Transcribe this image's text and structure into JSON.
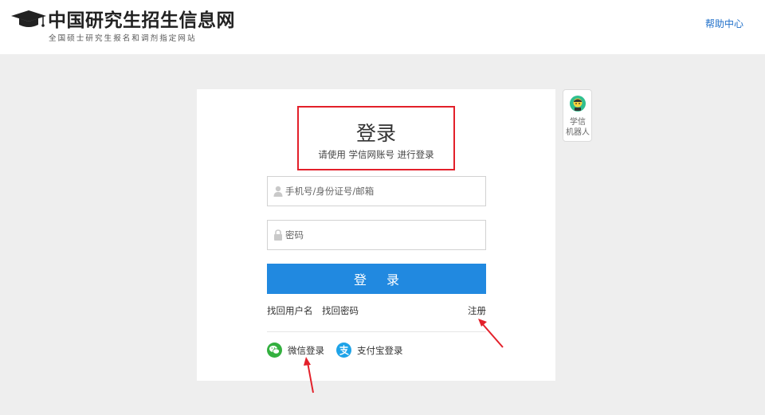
{
  "header": {
    "logo_title": "中国研究生招生信息网",
    "logo_subtitle": "全国硕士研究生报名和调剂指定网站",
    "help_link": "帮助中心"
  },
  "login": {
    "title": "登录",
    "subtitle": "请使用 学信网账号 进行登录",
    "username_placeholder": "手机号/身份证号/邮箱",
    "password_placeholder": "密码",
    "submit_label": "登 录",
    "forgot_username": "找回用户名",
    "forgot_password": "找回密码",
    "register": "注册",
    "wechat_login": "微信登录",
    "alipay_login": "支付宝登录"
  },
  "robot": {
    "label_line1": "学信",
    "label_line2": "机器人"
  },
  "colors": {
    "primary_button": "#2189e0",
    "link_blue": "#1f6fc9",
    "highlight_red": "#e3202a",
    "annotation_arrow": "#e3202a",
    "wechat_green": "#33b03f",
    "alipay_blue": "#1ea3e8",
    "page_background": "#eeeeee"
  },
  "icons": {
    "logo": "graduation-cap-icon",
    "username": "user-icon",
    "password": "lock-icon",
    "wechat": "wechat-icon",
    "alipay": "alipay-icon",
    "robot": "robot-icon"
  }
}
